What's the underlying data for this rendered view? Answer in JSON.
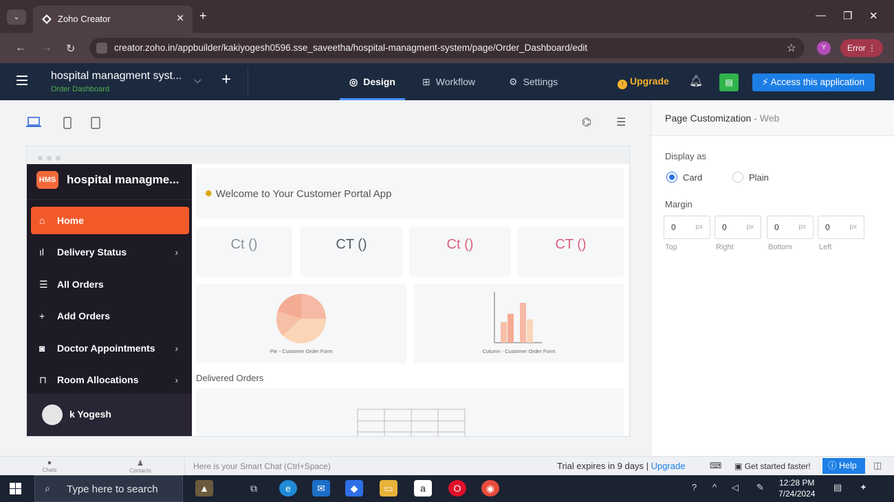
{
  "browser": {
    "tab_title": "Zoho Creator",
    "tab_close": "✕",
    "new_tab": "+",
    "url": "creator.zoho.in/appbuilder/kakiyogesh0596.sse_saveetha/hospital-managment-system/page/Order_Dashboard/edit",
    "profile_initial": "Y",
    "error_label": "Error"
  },
  "header": {
    "app_name": "hospital managment syst...",
    "page_name": "Order Dashboard",
    "tabs": [
      {
        "label": "Design",
        "icon": "palette-icon"
      },
      {
        "label": "Workflow",
        "icon": "workflow-icon"
      },
      {
        "label": "Settings",
        "icon": "gear-icon"
      }
    ],
    "upgrade": "Upgrade",
    "access_button": "Access this application"
  },
  "app_preview": {
    "brand_badge": "HMS",
    "brand_name": "hospital managme...",
    "nav": [
      {
        "label": "Home",
        "icon": "home-icon",
        "active": true
      },
      {
        "label": "Delivery Status",
        "icon": "bar-chart-icon",
        "has_children": true
      },
      {
        "label": "All Orders",
        "icon": "list-icon"
      },
      {
        "label": "Add Orders",
        "icon": "plus-icon"
      },
      {
        "label": "Doctor Appointments",
        "icon": "camera-icon",
        "has_children": true
      },
      {
        "label": "Room Allocations",
        "icon": "bed-icon",
        "has_children": true
      }
    ],
    "user_name": "k Yogesh",
    "welcome": "Welcome to Your Customer Portal App",
    "stats": [
      {
        "value": "Ct ()",
        "color": "#8a8f99"
      },
      {
        "value": "CT ()",
        "color": "#555b66"
      },
      {
        "value": "Ct ()",
        "color": "#d9607c"
      },
      {
        "value": "CT ()",
        "color": "#d9607c"
      }
    ],
    "charts": [
      {
        "caption": "Pie - Customer Order Form"
      },
      {
        "caption": "Column - Customer Order Form"
      }
    ],
    "delivered_label": "Delivered Orders"
  },
  "properties": {
    "title": "Page Customization",
    "title_suffix": "- Web",
    "display_as_label": "Display as",
    "display_options": [
      "Card",
      "Plain"
    ],
    "display_selected": "Card",
    "margin_label": "Margin",
    "margins": [
      {
        "side": "Top",
        "value": "0",
        "unit": "px"
      },
      {
        "side": "Right",
        "value": "0",
        "unit": "px"
      },
      {
        "side": "Bottom",
        "value": "0",
        "unit": "px"
      },
      {
        "side": "Left",
        "value": "0",
        "unit": "px"
      }
    ]
  },
  "chatbar": {
    "chats": "Chats",
    "contacts": "Contacts",
    "placeholder": "Here is your Smart Chat (Ctrl+Space)",
    "trial_text": "Trial expires in 9 days |",
    "trial_upgrade": "Upgrade",
    "get_started": "Get started faster!",
    "help": "Help"
  },
  "taskbar": {
    "search_placeholder": "Type here to search",
    "time": "12:28 PM",
    "date": "7/24/2024"
  },
  "colors": {
    "accent": "#f25a2a",
    "header_bg": "#1c2a3f",
    "primary_blue": "#1d7fe6"
  }
}
